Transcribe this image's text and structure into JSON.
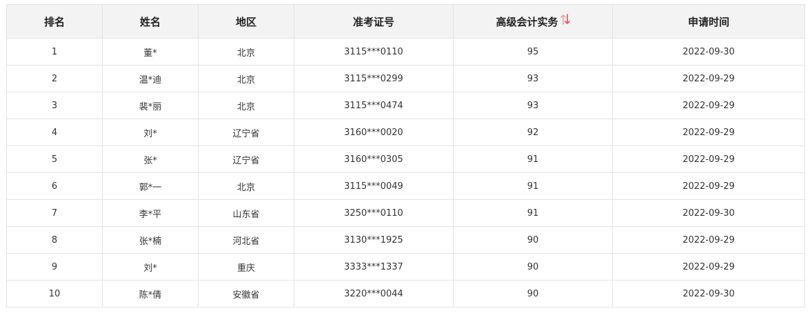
{
  "table": {
    "headers": [
      "排名",
      "姓名",
      "地区",
      "准考证号",
      "高级会计实务",
      "申请时间"
    ],
    "sort_icon": "sort-arrows-icon",
    "sort_icon_colors": {
      "up": "#f4a0a0",
      "down": "#e85050"
    },
    "rows": [
      [
        "1",
        "董*",
        "北京",
        "3115***0110",
        "95",
        "2022-09-30"
      ],
      [
        "2",
        "温*迪",
        "北京",
        "3115***0299",
        "93",
        "2022-09-29"
      ],
      [
        "3",
        "裴*丽",
        "北京",
        "3115***0474",
        "93",
        "2022-09-29"
      ],
      [
        "4",
        "刘*",
        "辽宁省",
        "3160***0020",
        "92",
        "2022-09-29"
      ],
      [
        "5",
        "张*",
        "辽宁省",
        "3160***0305",
        "91",
        "2022-09-29"
      ],
      [
        "6",
        "郭*一",
        "北京",
        "3115***0049",
        "91",
        "2022-09-29"
      ],
      [
        "7",
        "李*平",
        "山东省",
        "3250***0110",
        "91",
        "2022-09-30"
      ],
      [
        "8",
        "张*楠",
        "河北省",
        "3130***1925",
        "90",
        "2022-09-29"
      ],
      [
        "9",
        "刘*",
        "重庆",
        "3333***1337",
        "90",
        "2022-09-29"
      ],
      [
        "10",
        "陈*倩",
        "安徽省",
        "3220***0044",
        "90",
        "2022-09-30"
      ]
    ]
  }
}
